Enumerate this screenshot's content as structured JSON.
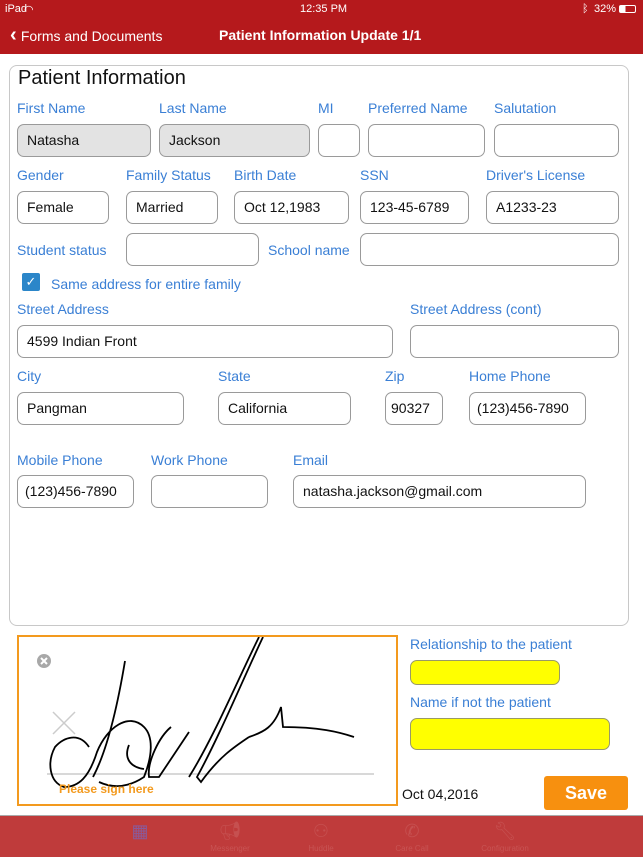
{
  "status_bar": {
    "device": "iPad",
    "time": "12:35 PM",
    "battery": "32%"
  },
  "nav": {
    "back_label": "Forms and Documents",
    "title": "Patient Information Update  1/1"
  },
  "form": {
    "title": "Patient Information",
    "labels": {
      "first_name": "First Name",
      "last_name": "Last Name",
      "mi": "MI",
      "preferred_name": "Preferred Name",
      "salutation": "Salutation",
      "gender": "Gender",
      "family_status": "Family Status",
      "birth_date": "Birth Date",
      "ssn": "SSN",
      "drivers_license": "Driver's License",
      "student_status": "Student status",
      "school_name": "School name",
      "same_address": "Same address for entire family",
      "street": "Street Address",
      "street2": "Street Address (cont)",
      "city": "City",
      "state": "State",
      "zip": "Zip",
      "home_phone": "Home Phone",
      "mobile_phone": "Mobile Phone",
      "work_phone": "Work Phone",
      "email": "Email"
    },
    "values": {
      "first_name": "Natasha",
      "last_name": "Jackson",
      "mi": "",
      "preferred_name": "",
      "salutation": "",
      "gender": "Female",
      "family_status": "Married",
      "birth_date": "Oct 12,1983",
      "ssn": "123-45-6789",
      "drivers_license": "A1233-23",
      "student_status": "",
      "school_name": "",
      "same_address_checked": true,
      "street": "4599 Indian Front",
      "street2": "",
      "city": "Pangman",
      "state": "California",
      "zip": "90327",
      "home_phone": "(123)456-7890",
      "mobile_phone": "(123)456-7890",
      "work_phone": "",
      "email": "natasha.jackson@gmail.com"
    }
  },
  "signature": {
    "placeholder": "Please sign here",
    "relationship_label": "Relationship to the patient",
    "relationship_value": "",
    "name_label": "Name if not the patient",
    "name_value": "",
    "date": "Oct 04,2016",
    "save_label": "Save"
  },
  "tabbar": {
    "items": [
      {
        "label": "",
        "icon": "forms-icon",
        "active": true
      },
      {
        "label": "Messenger",
        "icon": "megaphone-icon"
      },
      {
        "label": "Huddle",
        "icon": "group-icon"
      },
      {
        "label": "Care Call",
        "icon": "phone-icon"
      },
      {
        "label": "Configuration",
        "icon": "wrench-icon"
      }
    ]
  },
  "colors": {
    "header": "#b5191c",
    "label": "#3a7fd5",
    "accent": "#f7900f",
    "highlight": "#ffff00"
  }
}
